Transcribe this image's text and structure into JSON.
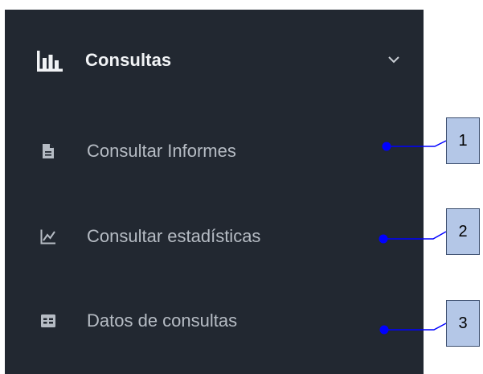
{
  "menu": {
    "header": {
      "label": "Consultas",
      "icon": "bar-chart-icon",
      "toggle_icon": "chevron-down-icon"
    },
    "items": [
      {
        "label": "Consultar Informes",
        "icon": "file-text-icon"
      },
      {
        "label": "Consultar estadísticas",
        "icon": "line-chart-icon"
      },
      {
        "label": "Datos de consultas",
        "icon": "table-icon"
      }
    ]
  },
  "callouts": [
    "1",
    "2",
    "3"
  ],
  "colors": {
    "sidebar_bg": "#222831",
    "header_text": "#f1f3f5",
    "item_text": "#b6bcc4",
    "callout_fill": "#b4c7e7",
    "connector": "#0000ff"
  }
}
